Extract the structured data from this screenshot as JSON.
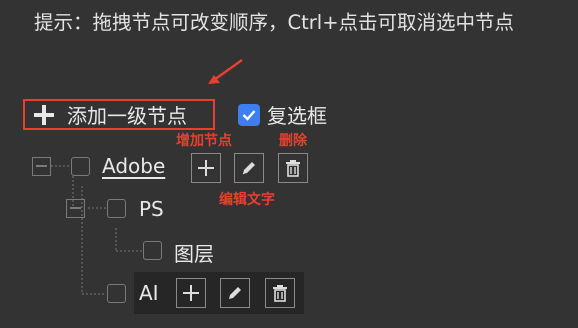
{
  "hint": {
    "text": "提示：拖拽节点可改变顺序，Ctrl+点击可取消选中节点"
  },
  "toolbar": {
    "add_root_label": "添加一级节点",
    "multiselect_label": "复选框",
    "multiselect_checked": true
  },
  "annotations": {
    "add_node": "增加节点",
    "delete": "删除",
    "edit_text": "编辑文字"
  },
  "tree": {
    "adobe": {
      "label": "Adobe"
    },
    "ps": {
      "label": "PS"
    },
    "layer": {
      "label": "图层"
    },
    "ai": {
      "label": "AI"
    }
  },
  "colors": {
    "background": "#333333",
    "accent_red": "#e8402f",
    "checkbox_blue": "#3d7ff0"
  }
}
